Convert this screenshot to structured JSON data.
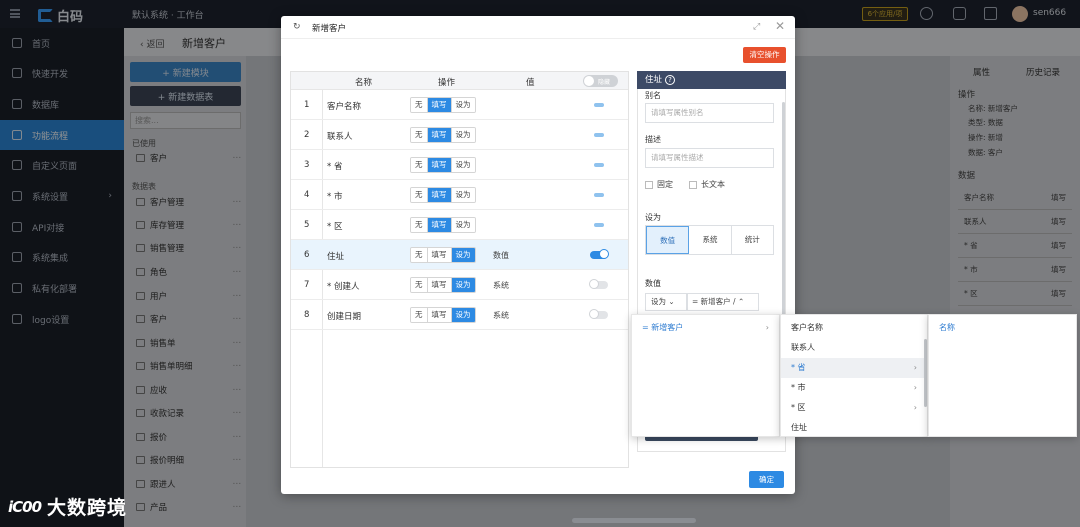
{
  "topbar": {
    "logo": "白码",
    "breadcrumb": "默认系统 · 工作台",
    "badge": "6个应用/项",
    "user": "sen666"
  },
  "nav": {
    "items": [
      {
        "label": "首页"
      },
      {
        "label": "快速开发"
      },
      {
        "label": "数据库"
      },
      {
        "label": "功能流程"
      },
      {
        "label": "自定义页面"
      },
      {
        "label": "系统设置",
        "arrow": "›"
      },
      {
        "label": "API对接"
      },
      {
        "label": "系统集成"
      },
      {
        "label": "私有化部署"
      },
      {
        "label": "logo设置"
      }
    ]
  },
  "subheader": {
    "back": "‹  返回",
    "title": "新增客户"
  },
  "modules": {
    "add_module": "+  新建模块",
    "add_table": "+  新建数据表",
    "search_placeholder": "搜索...",
    "used_label": "已使用",
    "used_item": "客户",
    "tables_label": "数据表",
    "items": [
      "客户管理",
      "库存管理",
      "销售管理",
      "角色",
      "用户",
      "客户",
      "销售单",
      "销售单明细",
      "应收",
      "收款记录",
      "报价",
      "报价明细",
      "跟进人",
      "产品"
    ]
  },
  "right_panel": {
    "tabs": [
      "属性",
      "历史记录"
    ],
    "section1": "操作",
    "props": [
      "名称:  新增客户",
      "类型:  数据",
      "操作:  新增",
      "数据:  客户"
    ],
    "section2": "数据",
    "grid": [
      [
        "客户名称",
        "填写"
      ],
      [
        "联系人",
        "填写"
      ],
      [
        "* 省",
        "填写"
      ],
      [
        "* 市",
        "填写"
      ],
      [
        "* 区",
        "填写"
      ]
    ]
  },
  "modal": {
    "title": "新增客户",
    "refresh_icon": "↻",
    "expand_icon": "⤢",
    "close_icon": "✕",
    "clear_button": "清空操作",
    "ok_button": "确定",
    "table": {
      "headers": {
        "name": "名称",
        "op": "操作",
        "value": "值",
        "toggle": "隐藏"
      },
      "rows": [
        {
          "n": "1",
          "name": "客户名称",
          "ops": [
            "无",
            "填写",
            "设为"
          ],
          "active": 1,
          "value": "",
          "switch": "bar"
        },
        {
          "n": "2",
          "name": "联系人",
          "ops": [
            "无",
            "填写",
            "设为"
          ],
          "active": 1,
          "value": "",
          "switch": "bar"
        },
        {
          "n": "3",
          "name": "* 省",
          "ops": [
            "无",
            "填写",
            "设为"
          ],
          "active": 1,
          "value": "",
          "switch": "bar"
        },
        {
          "n": "4",
          "name": "* 市",
          "ops": [
            "无",
            "填写",
            "设为"
          ],
          "active": 1,
          "value": "",
          "switch": "bar"
        },
        {
          "n": "5",
          "name": "* 区",
          "ops": [
            "无",
            "填写",
            "设为"
          ],
          "active": 1,
          "value": "",
          "switch": "bar"
        },
        {
          "n": "6",
          "name": "住址",
          "ops": [
            "无",
            "填写",
            "设为"
          ],
          "active": 2,
          "value": "数值",
          "switch": "on"
        },
        {
          "n": "7",
          "name": "* 创建人",
          "ops": [
            "无",
            "填写",
            "设为"
          ],
          "active": 2,
          "value": "系统",
          "switch": "off"
        },
        {
          "n": "8",
          "name": "创建日期",
          "ops": [
            "无",
            "填写",
            "设为"
          ],
          "active": 2,
          "value": "系统",
          "switch": "off"
        }
      ]
    },
    "prop": {
      "header": "住址",
      "help_icon": "?",
      "alias_label": "别名",
      "alias_placeholder": "请填写属性别名",
      "desc_label": "描述",
      "desc_placeholder": "请填写属性描述",
      "fixed": "固定",
      "longtext": "长文本",
      "setto_label": "设为",
      "setto_options": [
        "数值",
        "系统",
        "统计"
      ],
      "value_label": "数值",
      "value_mode": "设为  ⌄",
      "value_path": "= 新增客户 / ⌃"
    }
  },
  "cascade": {
    "col1": [
      {
        "label": "= 新增客户",
        "chev": "›"
      }
    ],
    "col2": [
      {
        "label": "客户名称",
        "chev": ""
      },
      {
        "label": "联系人",
        "chev": ""
      },
      {
        "label": "* 省",
        "chev": "›"
      },
      {
        "label": "* 市",
        "chev": "›"
      },
      {
        "label": "* 区",
        "chev": "›"
      },
      {
        "label": "住址",
        "chev": ""
      }
    ],
    "col3": [
      {
        "label": "名称"
      }
    ]
  },
  "watermark": {
    "mark": "iC00",
    "text": "大数跨境"
  }
}
